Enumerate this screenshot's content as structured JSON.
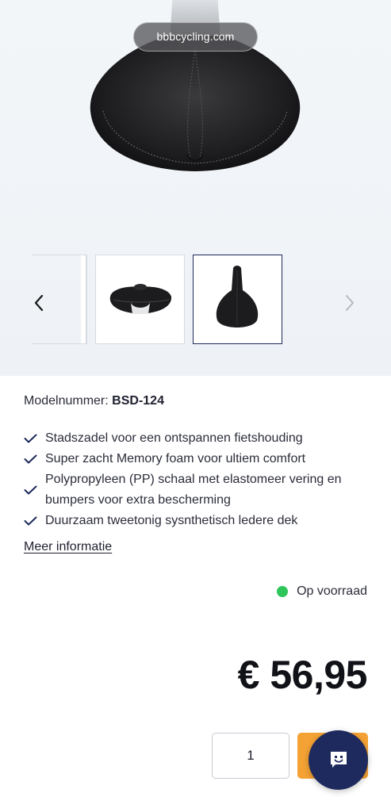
{
  "browser": {
    "url_label": "bbbcycling.com"
  },
  "gallery": {
    "prev_icon": "chevron-left-icon",
    "next_icon": "chevron-right-icon",
    "thumbnails": [
      {
        "name": "thumb-saddle-side"
      },
      {
        "name": "thumb-saddle-top",
        "selected": true
      }
    ]
  },
  "product": {
    "model_label": "Modelnummer:",
    "model_value": "BSD-124",
    "features": [
      "Stadszadel voor een ontspannen fietshouding",
      "Super zacht Memory foam voor ultiem comfort",
      "Polypropyleen (PP) schaal met elastomeer vering en bumpers voor extra bescherming",
      "Duurzaam tweetonig sysnthetisch ledere dek"
    ],
    "more_info": "Meer informatie",
    "stock_status": "Op voorraad",
    "stock_color": "#2ec55b",
    "price": "€ 56,95"
  },
  "purchase": {
    "quantity": "1",
    "cart_color": "#f4a234"
  },
  "chat": {
    "icon": "chat-smiley-icon",
    "color": "#1e2a5e"
  }
}
